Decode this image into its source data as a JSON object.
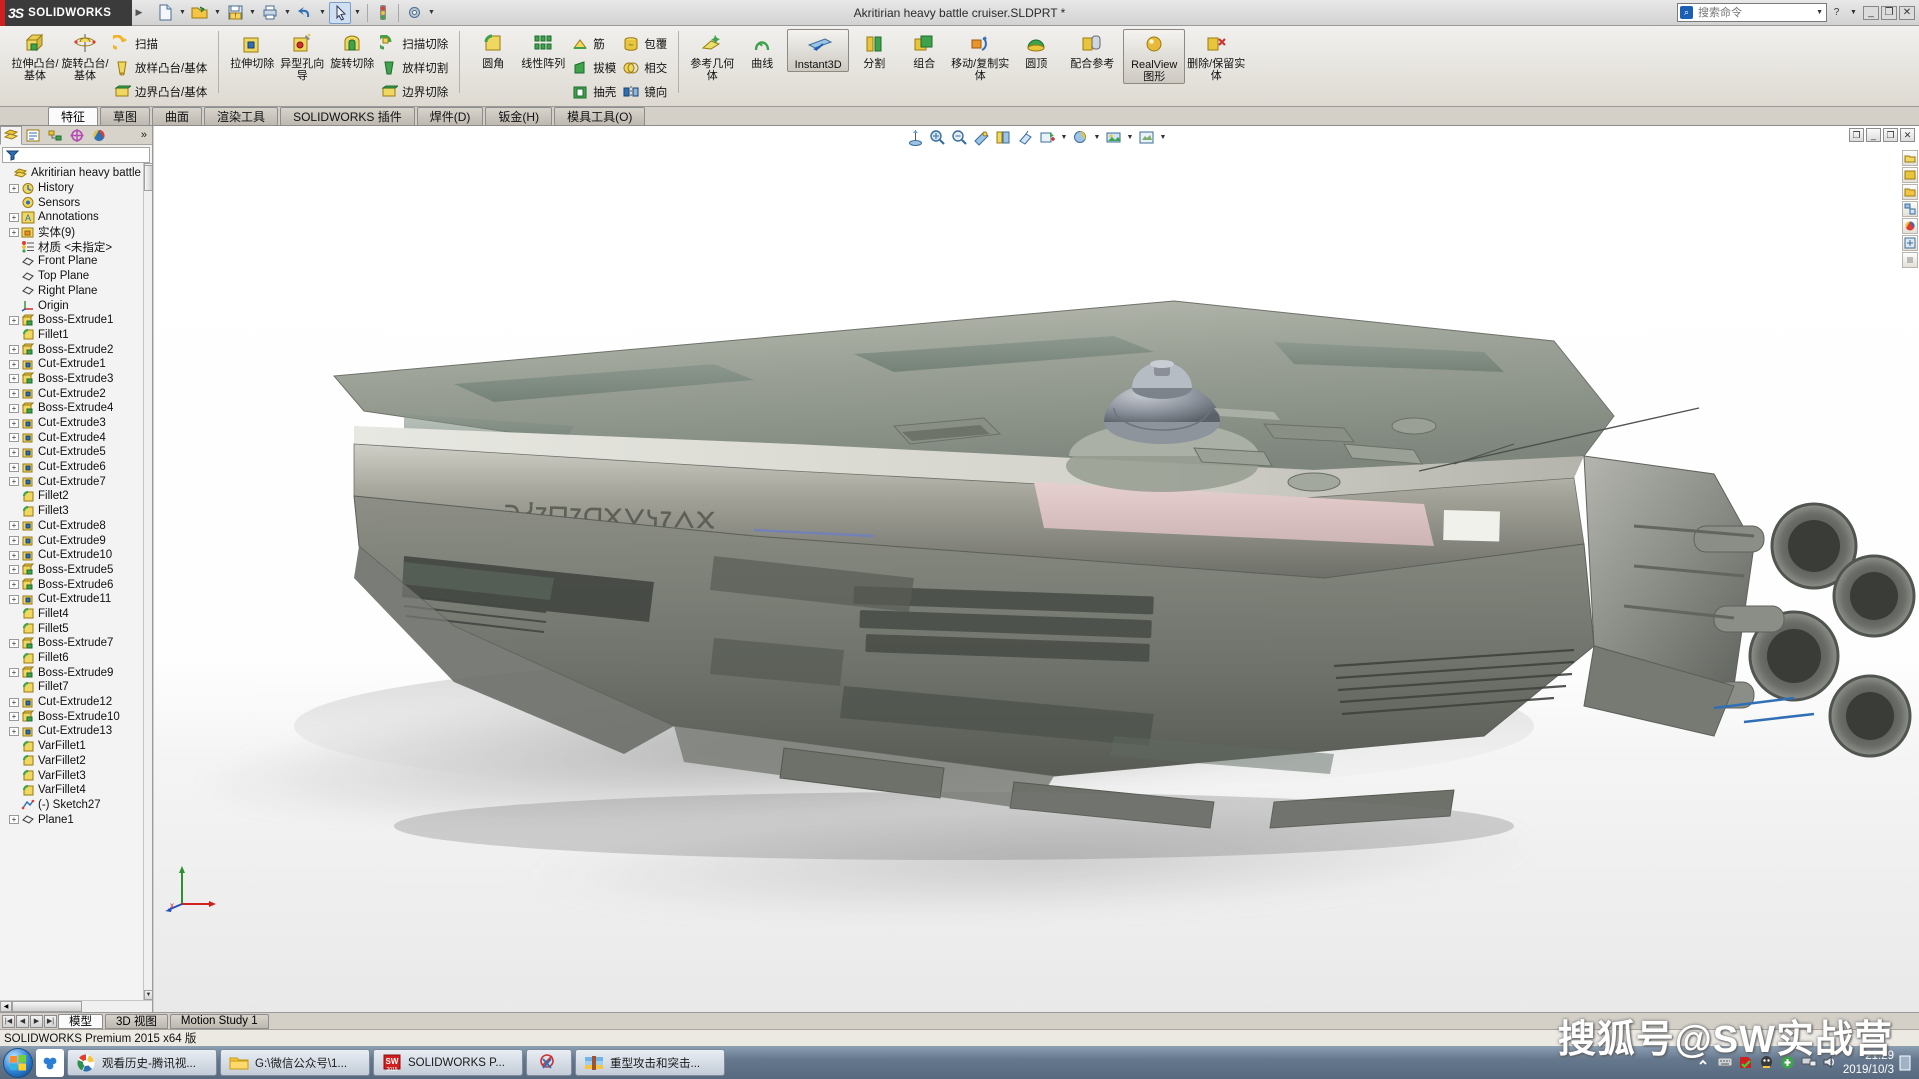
{
  "window": {
    "title": "Akritirian heavy battle cruiser.SLDPRT *",
    "brand": "SOLIDWORKS",
    "brand_mark": "3S"
  },
  "search": {
    "placeholder": "搜索命令"
  },
  "quickaccess": [
    {
      "name": "new-document",
      "icon": "page"
    },
    {
      "name": "open-document",
      "icon": "folder"
    },
    {
      "name": "save-document",
      "icon": "save"
    },
    {
      "name": "print-document",
      "icon": "printer"
    },
    {
      "name": "undo",
      "icon": "undo"
    },
    {
      "name": "select",
      "icon": "cursor"
    },
    {
      "name": "rebuild",
      "icon": "traffic"
    },
    {
      "name": "options",
      "icon": "gear"
    }
  ],
  "ribbon": {
    "groups": [
      {
        "big": [
          {
            "label": "拉伸凸台/基体",
            "icon": "boss-extrude",
            "active": false
          },
          {
            "label": "旋转凸台/基体",
            "icon": "revolve-boss",
            "active": false
          }
        ],
        "small": [
          {
            "label": "扫描",
            "icon": "sweep"
          },
          {
            "label": "放样凸台/基体",
            "icon": "loft"
          },
          {
            "label": "边界凸台/基体",
            "icon": "boundary-boss"
          }
        ]
      },
      {
        "big": [
          {
            "label": "拉伸切除",
            "icon": "cut-extrude",
            "active": false
          },
          {
            "label": "异型孔向导",
            "icon": "hole-wizard",
            "active": false
          },
          {
            "label": "旋转切除",
            "icon": "revolve-cut",
            "active": false
          }
        ],
        "small": [
          {
            "label": "扫描切除",
            "icon": "sweep-cut"
          },
          {
            "label": "放样切割",
            "icon": "loft-cut"
          },
          {
            "label": "边界切除",
            "icon": "boundary-cut"
          }
        ]
      },
      {
        "big": [
          {
            "label": "圆角",
            "icon": "fillet",
            "active": false
          },
          {
            "label": "线性阵列",
            "icon": "linear-pattern",
            "active": false
          }
        ],
        "small": [
          {
            "label": "筋",
            "icon": "rib"
          },
          {
            "label": "拔模",
            "icon": "draft"
          },
          {
            "label": "抽壳",
            "icon": "shell"
          },
          {
            "label": "包覆",
            "icon": "wrap"
          },
          {
            "label": "相交",
            "icon": "intersect"
          },
          {
            "label": "镜向",
            "icon": "mirror"
          }
        ]
      },
      {
        "big": [
          {
            "label": "参考几何体",
            "icon": "reference-geometry",
            "active": false
          },
          {
            "label": "曲线",
            "icon": "curves",
            "active": false
          },
          {
            "label": "Instant3D",
            "icon": "instant3d",
            "active": true
          },
          {
            "label": "分割",
            "icon": "split",
            "active": false
          },
          {
            "label": "组合",
            "icon": "combine",
            "active": false
          },
          {
            "label": "移动/复制实体",
            "icon": "move-copy-body",
            "active": false
          },
          {
            "label": "圆顶",
            "icon": "dome",
            "active": false
          },
          {
            "label": "配合参考",
            "icon": "mate-reference",
            "active": false
          },
          {
            "label": "RealView 图形",
            "icon": "realview",
            "active": true
          },
          {
            "label": "删除/保留实体",
            "icon": "delete-keep-body",
            "active": false
          }
        ],
        "small": []
      }
    ]
  },
  "command_tabs": [
    {
      "label": "特征",
      "active": true
    },
    {
      "label": "草图",
      "active": false
    },
    {
      "label": "曲面",
      "active": false
    },
    {
      "label": "渲染工具",
      "active": false
    },
    {
      "label": "SOLIDWORKS 插件",
      "active": false
    },
    {
      "label": "焊件(D)",
      "active": false
    },
    {
      "label": "钣金(H)",
      "active": false
    },
    {
      "label": "模具工具(O)",
      "active": false
    }
  ],
  "tree_tabs": [
    {
      "name": "feature-manager",
      "active": true
    },
    {
      "name": "property-manager",
      "active": false
    },
    {
      "name": "configuration-manager",
      "active": false
    },
    {
      "name": "dimxpert-manager",
      "active": false
    },
    {
      "name": "display-manager",
      "active": false
    }
  ],
  "tree_more": "»",
  "feature_tree": [
    {
      "label": "Akritirian heavy battle crui",
      "icon": "part",
      "expandable": false,
      "root": true
    },
    {
      "label": "History",
      "icon": "history",
      "expandable": true
    },
    {
      "label": "Sensors",
      "icon": "sensors",
      "expandable": false
    },
    {
      "label": "Annotations",
      "icon": "annotations",
      "expandable": true
    },
    {
      "label": "实体(9)",
      "icon": "solid-bodies",
      "expandable": true
    },
    {
      "label": "材质 <未指定>",
      "icon": "material",
      "expandable": false
    },
    {
      "label": "Front Plane",
      "icon": "plane",
      "expandable": false
    },
    {
      "label": "Top Plane",
      "icon": "plane",
      "expandable": false
    },
    {
      "label": "Right Plane",
      "icon": "plane",
      "expandable": false
    },
    {
      "label": "Origin",
      "icon": "origin",
      "expandable": false
    },
    {
      "label": "Boss-Extrude1",
      "icon": "boss",
      "expandable": true
    },
    {
      "label": "Fillet1",
      "icon": "fillet",
      "expandable": false
    },
    {
      "label": "Boss-Extrude2",
      "icon": "boss",
      "expandable": true
    },
    {
      "label": "Cut-Extrude1",
      "icon": "cut",
      "expandable": true
    },
    {
      "label": "Boss-Extrude3",
      "icon": "boss",
      "expandable": true
    },
    {
      "label": "Cut-Extrude2",
      "icon": "cut",
      "expandable": true
    },
    {
      "label": "Boss-Extrude4",
      "icon": "boss",
      "expandable": true
    },
    {
      "label": "Cut-Extrude3",
      "icon": "cut",
      "expandable": true
    },
    {
      "label": "Cut-Extrude4",
      "icon": "cut",
      "expandable": true
    },
    {
      "label": "Cut-Extrude5",
      "icon": "cut",
      "expandable": true
    },
    {
      "label": "Cut-Extrude6",
      "icon": "cut",
      "expandable": true
    },
    {
      "label": "Cut-Extrude7",
      "icon": "cut",
      "expandable": true
    },
    {
      "label": "Fillet2",
      "icon": "fillet",
      "expandable": false
    },
    {
      "label": "Fillet3",
      "icon": "fillet",
      "expandable": false
    },
    {
      "label": "Cut-Extrude8",
      "icon": "cut",
      "expandable": true
    },
    {
      "label": "Cut-Extrude9",
      "icon": "cut",
      "expandable": true
    },
    {
      "label": "Cut-Extrude10",
      "icon": "cut",
      "expandable": true
    },
    {
      "label": "Boss-Extrude5",
      "icon": "boss",
      "expandable": true
    },
    {
      "label": "Boss-Extrude6",
      "icon": "boss",
      "expandable": true
    },
    {
      "label": "Cut-Extrude11",
      "icon": "cut",
      "expandable": true
    },
    {
      "label": "Fillet4",
      "icon": "fillet",
      "expandable": false
    },
    {
      "label": "Fillet5",
      "icon": "fillet",
      "expandable": false
    },
    {
      "label": "Boss-Extrude7",
      "icon": "boss",
      "expandable": true
    },
    {
      "label": "Fillet6",
      "icon": "fillet",
      "expandable": false
    },
    {
      "label": "Boss-Extrude9",
      "icon": "boss",
      "expandable": true
    },
    {
      "label": "Fillet7",
      "icon": "fillet",
      "expandable": false
    },
    {
      "label": "Cut-Extrude12",
      "icon": "cut",
      "expandable": true
    },
    {
      "label": "Boss-Extrude10",
      "icon": "boss",
      "expandable": true
    },
    {
      "label": "Cut-Extrude13",
      "icon": "cut",
      "expandable": true
    },
    {
      "label": "VarFillet1",
      "icon": "fillet",
      "expandable": false
    },
    {
      "label": "VarFillet2",
      "icon": "fillet",
      "expandable": false
    },
    {
      "label": "VarFillet3",
      "icon": "fillet",
      "expandable": false
    },
    {
      "label": "VarFillet4",
      "icon": "fillet",
      "expandable": false
    },
    {
      "label": "(-) Sketch27",
      "icon": "sketch",
      "expandable": false
    },
    {
      "label": "Plane1",
      "icon": "plane",
      "expandable": true
    }
  ],
  "view_toolbar": [
    {
      "name": "zoom-to-fit-icon"
    },
    {
      "name": "zoom-to-area-icon"
    },
    {
      "name": "previous-view-icon"
    },
    {
      "name": "section-view-icon"
    },
    {
      "name": "view-orientation-icon"
    },
    {
      "name": "display-style-icon"
    },
    {
      "name": "hide-show-items-icon"
    },
    {
      "name": "edit-appearance-icon"
    },
    {
      "name": "apply-scene-icon"
    },
    {
      "name": "view-settings-icon"
    }
  ],
  "bottom_tabs": [
    {
      "label": "模型",
      "active": true
    },
    {
      "label": "3D 视图",
      "active": false
    },
    {
      "label": "Motion Study 1",
      "active": false
    }
  ],
  "status_text": "SOLIDWORKS Premium 2015 x64 版",
  "taskbar": {
    "buttons": [
      {
        "label": "观看历史-腾讯视...",
        "icon": "browser"
      },
      {
        "label": "G:\\微信公众号\\1...",
        "icon": "folder"
      },
      {
        "label": "SOLIDWORKS P...",
        "icon": "solidworks"
      },
      {
        "label": "",
        "icon": "snip"
      },
      {
        "label": "重型攻击和突击...",
        "icon": "archive"
      }
    ],
    "tray_icons": [
      "show-desktop",
      "keyboard",
      "antivirus",
      "qq",
      "update",
      "network",
      "volume"
    ],
    "clock_time": "21:29",
    "clock_date": "2019/10/3"
  },
  "watermark": "搜狐号@SW实战营"
}
